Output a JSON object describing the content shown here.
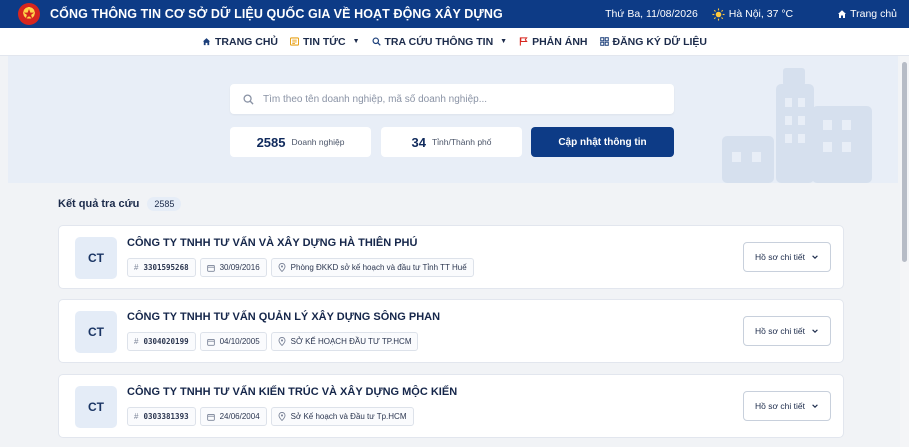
{
  "header": {
    "title": "CỔNG THÔNG TIN CƠ SỞ DỮ LIỆU QUỐC GIA VỀ HOẠT ĐỘNG XÂY DỰNG",
    "date": "Thứ Ba, 11/08/2026",
    "weather": "Hà Nội, 37 °C",
    "home": "Trang chủ"
  },
  "nav": {
    "items": [
      {
        "label": "TRANG CHỦ",
        "icon": "home-icon"
      },
      {
        "label": "TIN TỨC",
        "icon": "news-icon"
      },
      {
        "label": "TRA CỨU THÔNG TIN",
        "icon": "search-icon"
      },
      {
        "label": "PHẢN ÁNH",
        "icon": "flag-icon"
      },
      {
        "label": "ĐĂNG KÝ DỮ LIỆU",
        "icon": "grid-icon"
      }
    ]
  },
  "search": {
    "placeholder": "Tìm theo tên doanh nghiệp, mã số doanh nghiệp..."
  },
  "stats": {
    "enterprises_count": "2585",
    "enterprises_label": "Doanh nghiệp",
    "provinces_count": "34",
    "provinces_label": "Tỉnh/Thành phố",
    "update_label": "Cập nhật thông tin"
  },
  "results": {
    "title": "Kết quả tra cứu",
    "count": "2585",
    "detail_label": "Hồ sơ chi tiết",
    "items": [
      {
        "initials": "CT",
        "name": "CÔNG TY TNHH TƯ VẤN VÀ XÂY DỰNG HÀ THIÊN PHÚ",
        "tax_code": "3301595268",
        "date": "30/09/2016",
        "agency": "Phòng ĐKKD sở kế hoạch và đầu tư Tỉnh TT Huế"
      },
      {
        "initials": "CT",
        "name": "CÔNG TY TNHH TƯ VẤN QUẢN LÝ XÂY DỰNG SÔNG PHAN",
        "tax_code": "0304020199",
        "date": "04/10/2005",
        "agency": "SỞ KẾ HOẠCH ĐẦU TƯ TP.HCM"
      },
      {
        "initials": "CT",
        "name": "CÔNG TY TNHH TƯ VẤN KIẾN TRÚC VÀ XÂY DỰNG MỘC KIẾN",
        "tax_code": "0303381393",
        "date": "24/06/2004",
        "agency": "Sở Kế hoạch và Đầu tư Tp.HCM"
      }
    ]
  },
  "colors": {
    "primary": "#0d3b86",
    "hero_bg": "#e8eef7",
    "accent_news": "#e8a21a",
    "accent_flag": "#d7261e"
  }
}
